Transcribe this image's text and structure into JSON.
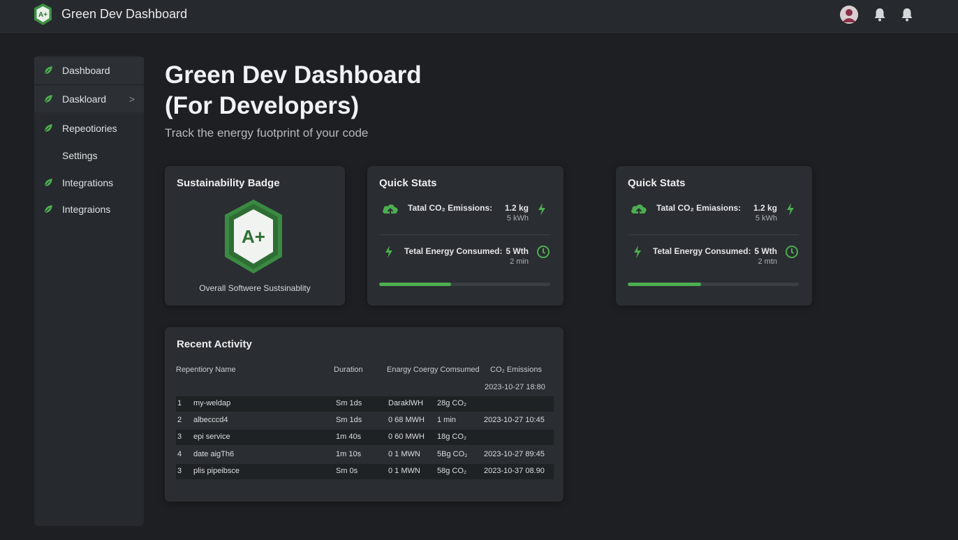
{
  "app": {
    "title": "Green Dev Dashboard",
    "logo_icon": "a-plus-shield-icon"
  },
  "topbar": {
    "avatar": "user-avatar",
    "icons": [
      "bell-icon",
      "bell-icon"
    ]
  },
  "colors": {
    "accent": "#4caf50",
    "background": "#1d1f22",
    "panel": "#2a2d31"
  },
  "sidebar": {
    "items": [
      {
        "label": "Dashboard",
        "icon": "leaf-icon"
      },
      {
        "label": "Daskloard",
        "icon": "leaf-icon",
        "chevron": ">"
      },
      {
        "label": "Repeotiories",
        "icon": "leaf-icon"
      },
      {
        "label": "Settings",
        "icon": ""
      },
      {
        "label": "Integrations",
        "icon": "leaf-icon"
      },
      {
        "label": "Integraions",
        "icon": "leaf-icon"
      }
    ]
  },
  "header": {
    "title_line1": "Green Dev Dashboard",
    "title_line2": "(For Developers)",
    "subtitle": "Track the energy fuotprint of your code"
  },
  "badge_card": {
    "title": "Sustainability Badge",
    "grade": "A+",
    "caption": "Overall Softwere Sustsinablity"
  },
  "quick_stats": [
    {
      "title": "Quick Stats",
      "co2_label": "Tatal CO₂ Emissions:",
      "co2_value": "1.2 kg",
      "co2_sub": "5 kWh",
      "energy_label": "Tetal Energy Consumed:",
      "energy_value": "5 Wth",
      "energy_sub": "2 min",
      "progress": 0.42
    },
    {
      "title": "Quick Stats",
      "co2_label": "Tatal CO₂ Emiasions:",
      "co2_value": "1.2 kg",
      "co2_sub": "5 kWh",
      "energy_label": "Tetal Energy Consumed:",
      "energy_value": "5 Wth",
      "energy_sub": "2 mtn",
      "progress": 0.43
    }
  ],
  "recent_activity": {
    "title": "Recent Activity",
    "columns": [
      "Repentiory Name",
      "Duration",
      "Enargy Coergy Comsumed",
      "CO₂ Emissions"
    ],
    "header_date": "2023-10-27 18:80",
    "rows": [
      [
        "1",
        "my-weldap",
        "Sm 1ds",
        "DaraklWH",
        "28g CO₂",
        ""
      ],
      [
        "2",
        "albecccd4",
        "Sm 1ds",
        "0 68 MWH",
        "1 min",
        "2023-10-27 10:45"
      ],
      [
        "3",
        "epi service",
        "1m 40s",
        "0 60 MWH",
        "18g CO₂",
        ""
      ],
      [
        "4",
        "date aigTh6",
        "1m 10s",
        "0 1 MWN",
        "5Bg CO₂",
        "2023-10-27 89:45"
      ],
      [
        "3",
        "plis pipeibsce",
        "Sm 0s",
        "0 1 MWN",
        "58g CO₂",
        "2023-10-37 08.90"
      ]
    ]
  }
}
